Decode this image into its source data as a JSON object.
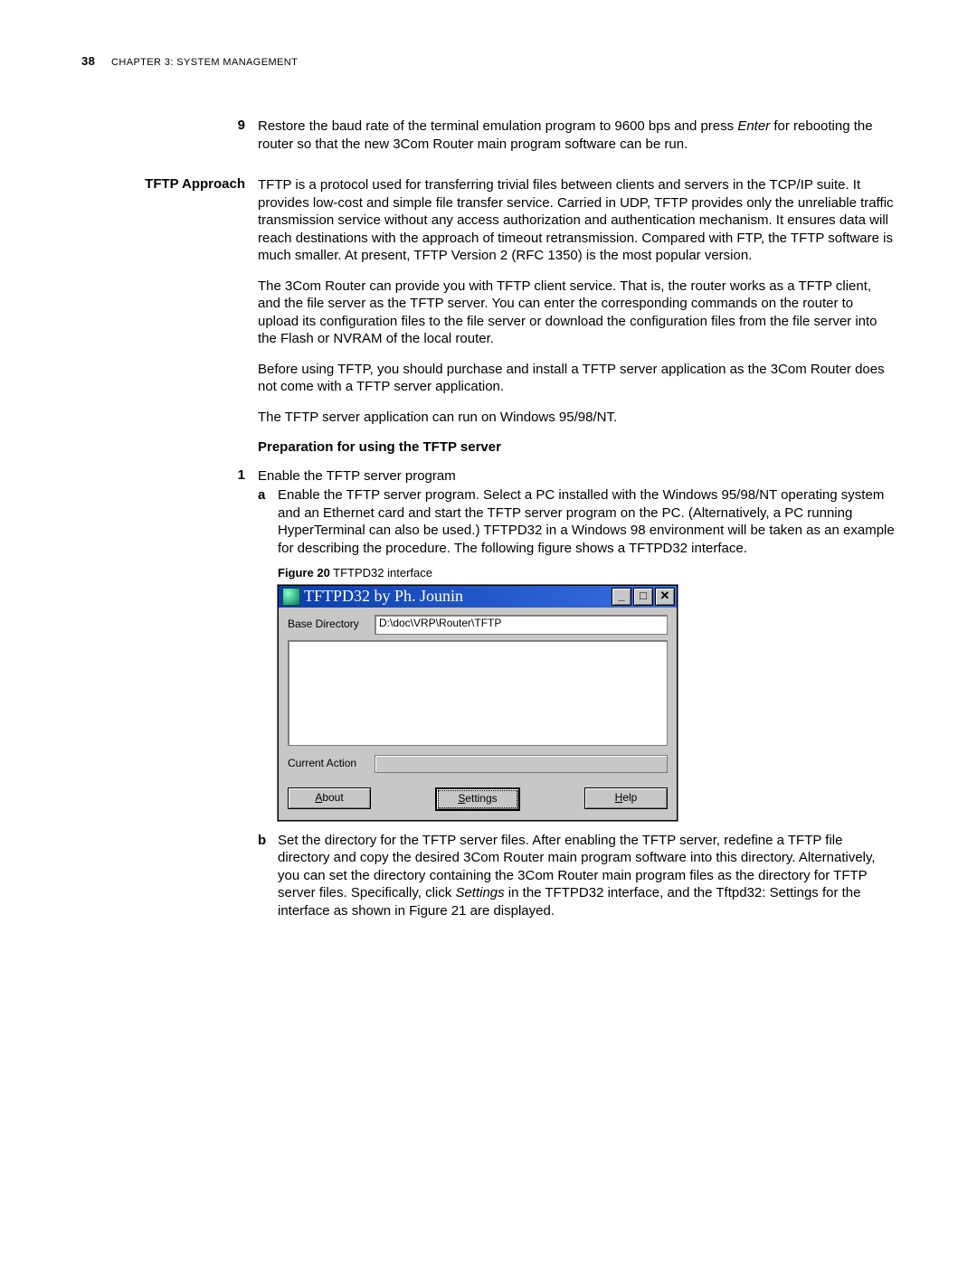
{
  "header": {
    "page_number": "38",
    "chapter_prefix": "C",
    "chapter_rest": "HAPTER",
    "chapter_num": " 3: S",
    "chapter_title_rest": "YSTEM ",
    "chapter_m": "M",
    "chapter_mgmt": "ANAGEMENT"
  },
  "step9": {
    "num": "9",
    "text_a": "Restore the baud rate of the terminal emulation program to 9600 bps and press ",
    "enter": "Enter",
    "text_b": " for rebooting the router so that the new 3Com Router main program software can be run."
  },
  "tftp": {
    "label": "TFTP Approach",
    "p1": "TFTP is a protocol used for transferring trivial files between clients and servers in the TCP/IP suite. It provides low-cost and simple file transfer service. Carried in UDP, TFTP provides only the unreliable traffic transmission service without any access authorization and authentication mechanism. It ensures data will reach destinations with the approach of timeout retransmission. Compared with FTP, the TFTP software is much smaller. At present, TFTP Version 2 (RFC 1350) is the most popular version.",
    "p2": "The 3Com Router can provide you with TFTP client service. That is, the router works as a TFTP client, and the file server as the TFTP server. You can enter the corresponding commands on the router to upload its configuration files to the file server or download the configuration files from the file server into the Flash or NVRAM of the local router.",
    "p3": "Before using TFTP, you should purchase and install a TFTP server application as the 3Com Router does not come with a TFTP server application.",
    "p4": "The TFTP server application can run on Windows 95/98/NT."
  },
  "prep": {
    "heading": "Preparation for using the TFTP server",
    "one_num": "1",
    "one_text": "Enable the TFTP server program",
    "a_letter": "a",
    "a_text": "Enable the TFTP server program. Select a PC installed with the Windows 95/98/NT operating system and an Ethernet card and start the TFTP server program on the PC. (Alternatively, a PC running HyperTerminal can also be used.) TFTPD32 in a Windows 98 environment will be taken as an example for describing the procedure. The following figure shows a TFTPD32 interface.",
    "figcap_no": "Figure 20",
    "figcap_text": "   TFTPD32 interface",
    "b_letter": "b",
    "b_text_a": "Set the directory for the TFTP server files. After enabling the TFTP server, redefine a TFTP file directory and copy the desired 3Com Router main program software into this directory. Alternatively, you can set the directory containing the 3Com Router main program files as the directory for TFTP server files. Specifically, click ",
    "b_settings": "Settings",
    "b_text_b": " in the TFTPD32 interface, and the Tftpd32: Settings for the interface as shown in Figure 21 are displayed."
  },
  "win": {
    "title": "TFTPD32 by Ph. Jounin",
    "basedir_label": "Base Directory",
    "basedir_value": "D:\\doc\\VRP\\Router\\TFTP",
    "curact_label": "Current Action",
    "btn_about_u": "A",
    "btn_about_rest": "bout",
    "btn_settings_u": "S",
    "btn_settings_rest": "ettings",
    "btn_help_u": "H",
    "btn_help_rest": "elp",
    "min": "_",
    "max": "□",
    "close": "✕"
  }
}
